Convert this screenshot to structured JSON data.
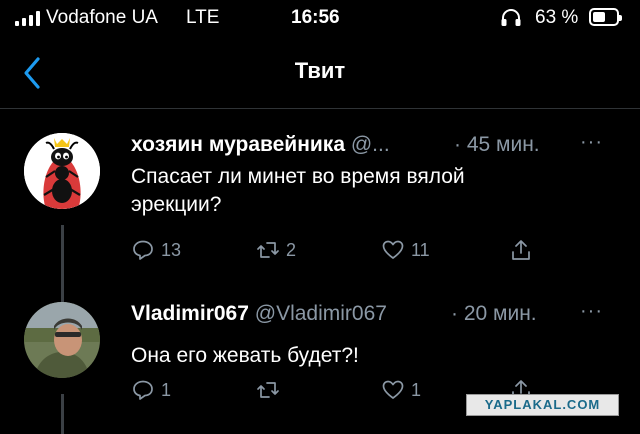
{
  "status_bar": {
    "carrier": "Vodafone UA",
    "network": "LTE",
    "time": "16:56",
    "battery_percent": "63 %",
    "battery_level": 0.63
  },
  "navbar": {
    "title": "Твит"
  },
  "tweets": [
    {
      "display_name": "хозяин муравейника",
      "handle": "@...",
      "time": "· 45 мин.",
      "more": "···",
      "text_line1": "Спасает ли минет во время вялой",
      "text_line2": "эрекции?",
      "replies": "13",
      "retweets": "2",
      "likes": "11"
    },
    {
      "display_name": "Vladimir067",
      "handle": "@Vladimir067",
      "time": "· 20 мин.",
      "more": "···",
      "text_line1": "Она его жевать будет?!",
      "replies": "1",
      "retweets": "",
      "likes": "1"
    }
  ],
  "watermark": "YAPLAKAL.COM",
  "icons": [
    "back-chevron-icon",
    "reply-icon",
    "retweet-icon",
    "like-icon",
    "share-icon",
    "headphones-icon",
    "battery-icon",
    "signal-icon"
  ],
  "colors": {
    "background": "#000000",
    "accent": "#1d9bf0",
    "muted": "#8b98a5",
    "divider": "#2f3336"
  }
}
